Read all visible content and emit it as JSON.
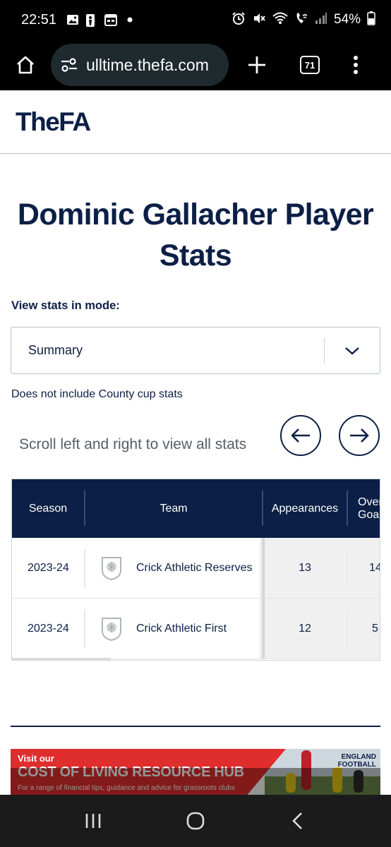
{
  "status_bar": {
    "time": "22:51",
    "battery": "54%",
    "left_icons": [
      "gallery-icon",
      "nba-icon",
      "calendar-icon",
      "dot-icon"
    ],
    "right_icons": [
      "alarm-icon",
      "mute-icon",
      "wifi-icon",
      "wifi-call-icon",
      "signal-icon",
      "battery-icon"
    ]
  },
  "browser": {
    "url": "ulltime.thefa.com",
    "tab_count": "71"
  },
  "site": {
    "logo": "TheFA"
  },
  "page": {
    "title": "Dominic Gallacher Player Stats",
    "mode_label": "View stats in mode:",
    "mode_value": "Summary",
    "disclaimer": "Does not include County cup stats",
    "scroll_hint": "Scroll left and right to view all stats"
  },
  "table": {
    "headers": [
      "Season",
      "Team",
      "Appearances",
      "Overall Goals"
    ],
    "header_visible": {
      "season": "Season",
      "team": "Team",
      "appearances": "Appearances",
      "overall_line1": "Over",
      "overall_line2": "Goa"
    },
    "rows": [
      {
        "season": "2023-24",
        "team": "Crick Athletic Reserves",
        "appearances": "13",
        "goals": "14"
      },
      {
        "season": "2023-24",
        "team": "Crick Athletic First",
        "appearances": "12",
        "goals": "5"
      }
    ]
  },
  "ad": {
    "small": "Visit our",
    "big": "COST OF LIVING RESOURCE HUB",
    "sub": "For a range of financial tips, guidance and advice for grassroots clubs",
    "brand_line1": "ENGLAND",
    "brand_line2": "FOOTBALL"
  },
  "colors": {
    "navy": "#0c1f46",
    "ad_red": "#e02d2d"
  }
}
